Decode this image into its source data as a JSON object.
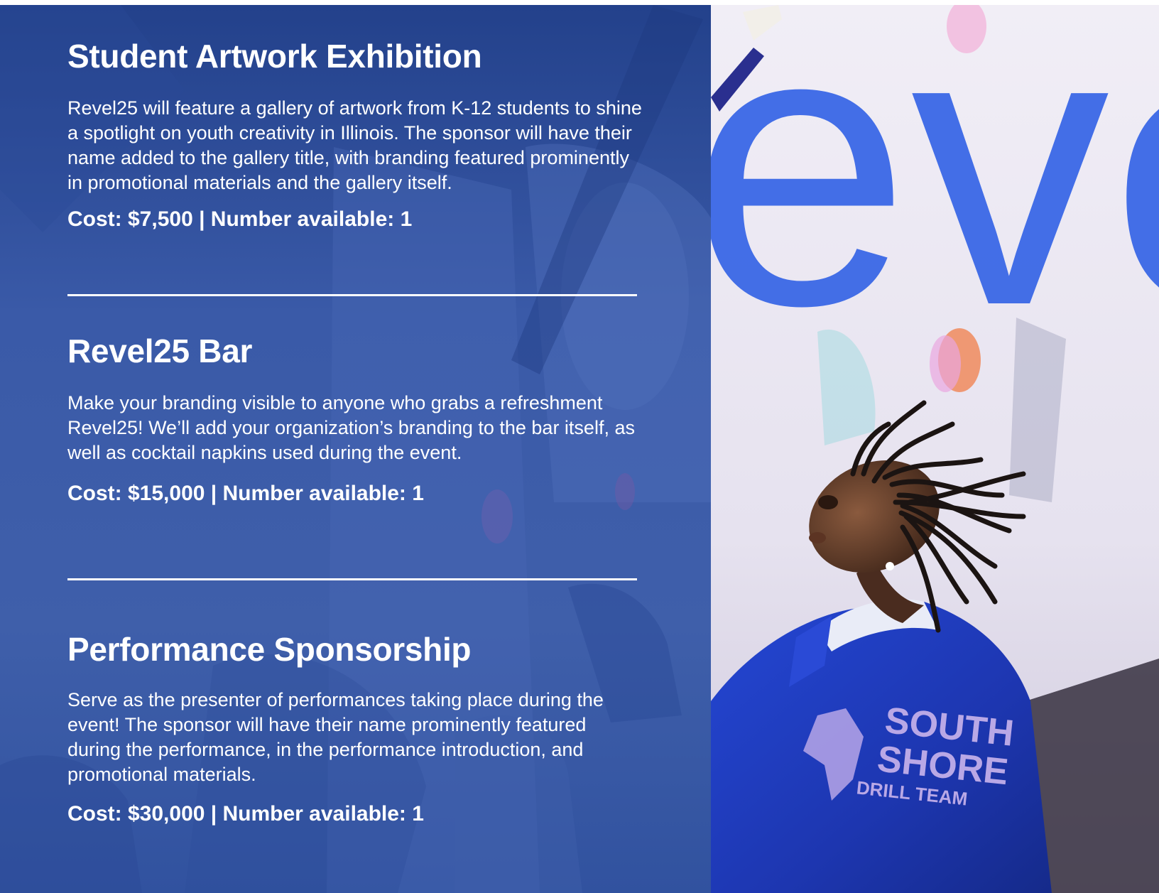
{
  "sections": [
    {
      "title": "Student Artwork Exhibition",
      "description": "Revel25 will feature a gallery of artwork from K-12 students to shine a spotlight on youth creativity in Illinois. The sponsor will have their name added to the gallery title, with branding featured prominently in promotional materials and the gallery itself.",
      "cost": "Cost: $7,500 | Number available: 1"
    },
    {
      "title": "Revel25 Bar",
      "description": "Make your branding visible to anyone who grabs a refreshment Revel25! We’ll add your organization’s branding to the bar itself, as well as cocktail napkins used during the event.",
      "cost": "Cost: $15,000 | Number available: 1"
    },
    {
      "title": "Performance Sponsorship",
      "description": "Serve as the presenter of performances taking place during the event! The sponsor will have their name prominently featured during the performance, in the performance introduction, and promotional materials.",
      "cost": "Cost: $30,000 | Number available: 1"
    }
  ],
  "photo": {
    "backdrop_text": "eve",
    "jacket_text": [
      "SOUTH",
      "SHORE",
      "DRILL TEAM"
    ]
  },
  "colors": {
    "panel_blue": "#3455a2",
    "backdrop_letters": "#2f5fe0",
    "jacket_blue": "#1f3fc4"
  }
}
